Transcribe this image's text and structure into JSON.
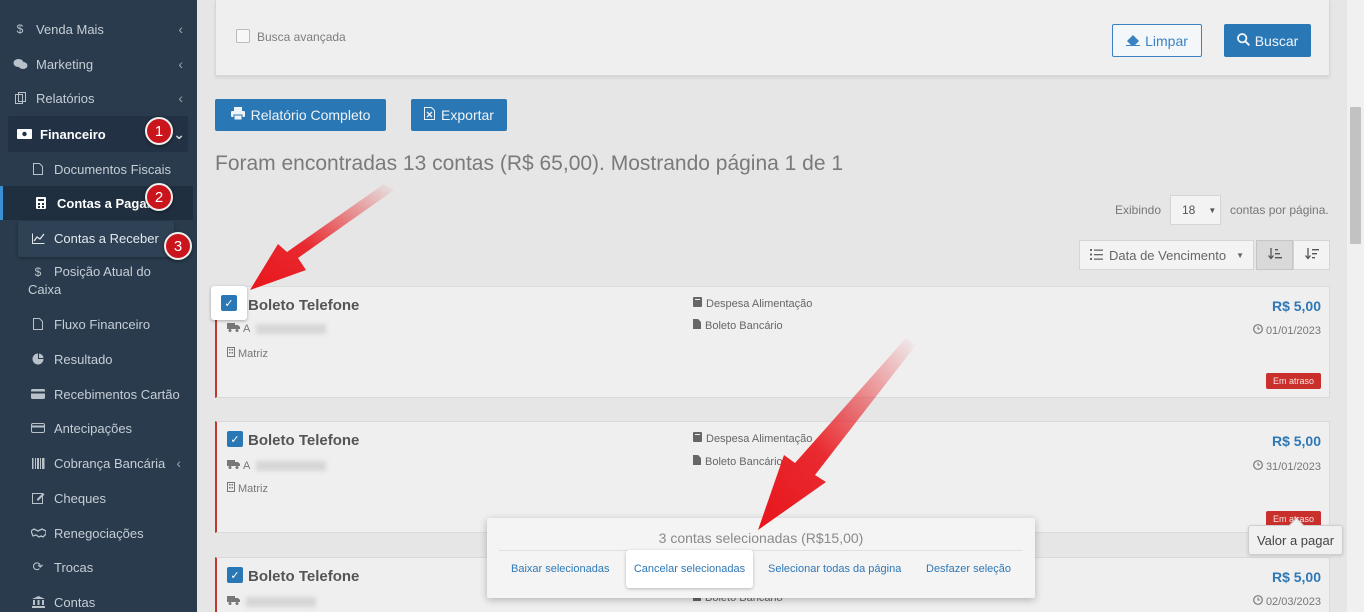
{
  "sidebar": {
    "items": [
      {
        "label": "Venda Mais",
        "icon": "dollar-icon"
      },
      {
        "label": "Marketing",
        "icon": "comments-icon"
      },
      {
        "label": "Relatórios",
        "icon": "copy-icon"
      },
      {
        "label": "Financeiro",
        "icon": "money-icon"
      },
      {
        "label": "Documentos Fiscais",
        "icon": "file-icon"
      },
      {
        "label": "Contas a Pagar",
        "icon": "calculator-icon"
      },
      {
        "label": "Contas a Receber",
        "icon": "line-chart-icon"
      },
      {
        "label": "Posição Atual do",
        "label2": "Caixa",
        "icon": "dollar-icon"
      },
      {
        "label": "Fluxo Financeiro",
        "icon": "file-icon"
      },
      {
        "label": "Resultado",
        "icon": "pie-chart-icon"
      },
      {
        "label": "Recebimentos Cartão",
        "icon": "credit-card-icon"
      },
      {
        "label": "Antecipações",
        "icon": "credit-card-icon"
      },
      {
        "label": "Cobrança Bancária",
        "icon": "barcode-icon"
      },
      {
        "label": "Cheques",
        "icon": "edit-icon"
      },
      {
        "label": "Renegociações",
        "icon": "handshake-icon"
      },
      {
        "label": "Trocas",
        "icon": "refresh-icon"
      },
      {
        "label": "Contas",
        "icon": "bank-icon"
      }
    ],
    "badges": [
      "1",
      "2",
      "3"
    ]
  },
  "filter": {
    "advanced_label": "Busca avançada",
    "clear_label": "Limpar",
    "search_label": "Buscar"
  },
  "toolbar": {
    "report_label": "Relatório Completo",
    "export_label": "Exportar"
  },
  "results": {
    "summary": "Foram encontradas 13 contas (R$ 65,00). Mostrando página 1 de 1",
    "showing_label": "Exibindo",
    "per_page_value": "18",
    "per_page_suffix": "contas por página.",
    "sort_label": "Data de Vencimento"
  },
  "cards": [
    {
      "title": "Boleto Telefone",
      "supplier_prefix": "A",
      "branch": "Matriz",
      "category": "Despesa Alimentação",
      "payment": "Boleto Bancário",
      "value": "R$ 5,00",
      "date": "01/01/2023",
      "status": "Em atraso"
    },
    {
      "title": "Boleto Telefone",
      "supplier_prefix": "A",
      "branch": "Matriz",
      "category": "Despesa Alimentação",
      "payment": "Boleto Bancário",
      "value": "R$ 5,00",
      "date": "31/01/2023",
      "status": "Em atraso"
    },
    {
      "title": "Boleto Telefone",
      "supplier_prefix": "",
      "branch": "",
      "category": "",
      "payment": "Boleto Bancário",
      "value": "R$ 5,00",
      "date": "02/03/2023",
      "status": ""
    }
  ],
  "selection": {
    "count_text": "3 contas selecionadas (R$15,00)",
    "actions": [
      "Baixar selecionadas",
      "Cancelar selecionadas",
      "Selecionar todas da página",
      "Desfazer seleção"
    ]
  },
  "tooltip": "Valor a pagar",
  "colors": {
    "sidebar_bg": "#293b4c",
    "primary": "#2a77b5",
    "danger": "#c9302c",
    "annotation_red": "#e8151b"
  }
}
